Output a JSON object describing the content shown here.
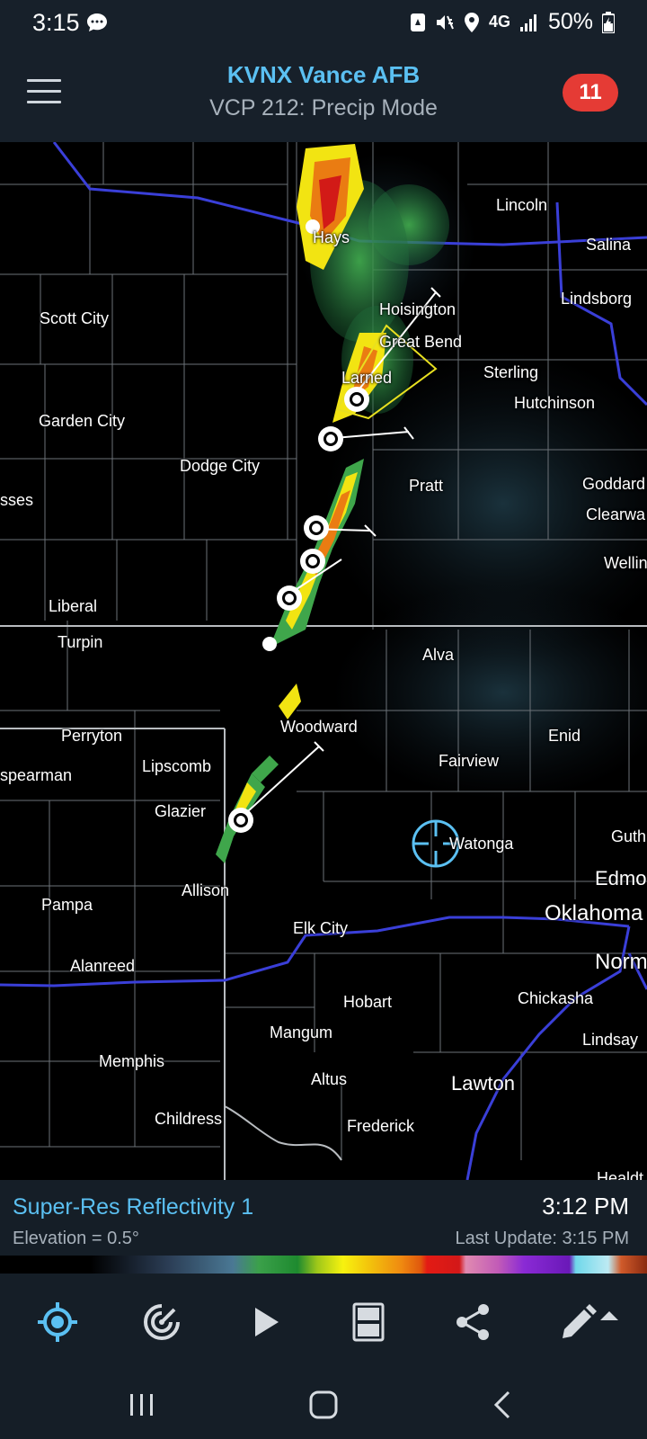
{
  "status_bar": {
    "time": "3:15",
    "network": "4G",
    "battery": "50%"
  },
  "header": {
    "title": "KVNX Vance AFB",
    "subtitle": "VCP 212: Precip Mode",
    "alert_count": "11"
  },
  "map": {
    "cities": [
      {
        "name": "Hays"
      },
      {
        "name": "Lincoln"
      },
      {
        "name": "Salina"
      },
      {
        "name": "Lindsborg"
      },
      {
        "name": "Scott City"
      },
      {
        "name": "Hoisington"
      },
      {
        "name": "Great Bend"
      },
      {
        "name": "Larned"
      },
      {
        "name": "Sterling"
      },
      {
        "name": "Hutchinson"
      },
      {
        "name": "Garden City"
      },
      {
        "name": "Dodge City"
      },
      {
        "name": "sses"
      },
      {
        "name": "Pratt"
      },
      {
        "name": "Goddard"
      },
      {
        "name": "Clearwa"
      },
      {
        "name": "Wellin"
      },
      {
        "name": "Liberal"
      },
      {
        "name": "Turpin"
      },
      {
        "name": "Alva"
      },
      {
        "name": "Perryton"
      },
      {
        "name": "Woodward"
      },
      {
        "name": "Enid"
      },
      {
        "name": "spearman"
      },
      {
        "name": "Lipscomb"
      },
      {
        "name": "Fairview"
      },
      {
        "name": "Glazier"
      },
      {
        "name": "Watonga"
      },
      {
        "name": "Guth"
      },
      {
        "name": "Allison"
      },
      {
        "name": "Edmo"
      },
      {
        "name": "Pampa"
      },
      {
        "name": "Elk City"
      },
      {
        "name": "Oklahoma"
      },
      {
        "name": "Alanreed"
      },
      {
        "name": "Norm"
      },
      {
        "name": "Hobart"
      },
      {
        "name": "Chickasha"
      },
      {
        "name": "Mangum"
      },
      {
        "name": "Lindsay"
      },
      {
        "name": "Memphis"
      },
      {
        "name": "Altus"
      },
      {
        "name": "Lawton"
      },
      {
        "name": "Childress"
      },
      {
        "name": "Frederick"
      },
      {
        "name": "Healdt"
      }
    ]
  },
  "product": {
    "name": "Super-Res Reflectivity 1",
    "elevation": "Elevation = 0.5°",
    "scan_time": "3:12 PM",
    "last_update": "Last Update: 3:15 PM"
  },
  "toolbar": {
    "items": [
      "location-icon",
      "radar-icon",
      "play-icon",
      "layout-icon",
      "share-icon",
      "edit-icon"
    ],
    "accent": "#5bc0f2"
  },
  "colors": {
    "header_bg": "#17202a",
    "accent": "#5bc0f2",
    "badge": "#e53b35"
  }
}
